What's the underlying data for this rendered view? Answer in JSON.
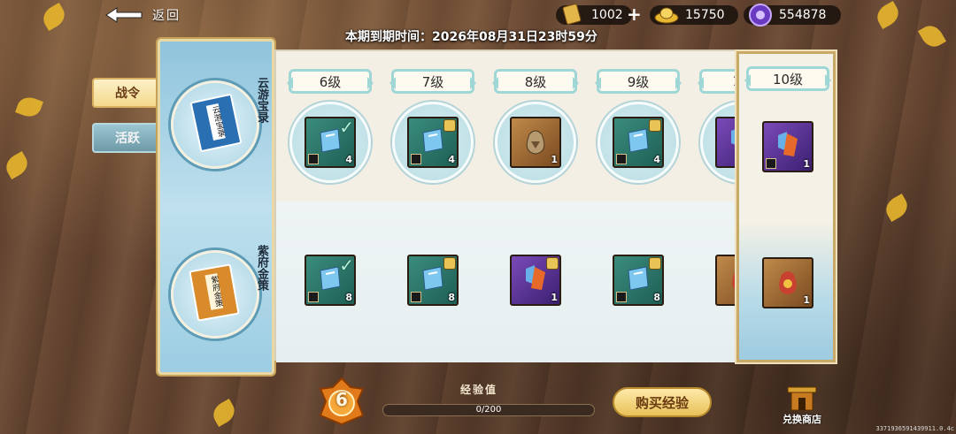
{
  "header": {
    "back_label": "返回",
    "expire_text": "本期到期时间：2026年08月31日23时59分"
  },
  "currencies": [
    {
      "name": "ticket",
      "icon": "ticket-icon",
      "value": "1002",
      "has_add": true
    },
    {
      "name": "gold-ingot",
      "icon": "gold-ingot-icon",
      "value": "15750",
      "has_add": false
    },
    {
      "name": "purple-gem",
      "icon": "purple-gem-icon",
      "value": "554878",
      "has_add": false
    }
  ],
  "side_tabs": [
    {
      "label": "战令",
      "active": true
    },
    {
      "label": "活跃",
      "active": false
    }
  ],
  "tracks": [
    {
      "label": "云游宝录",
      "book_title": "云游宝录",
      "color": "#2b6fb3"
    },
    {
      "label": "紫府金策",
      "book_title": "紫府金策",
      "color": "#d98a2a"
    }
  ],
  "levels": [
    {
      "label": "6级",
      "free": {
        "icon": "jade-shield-icon",
        "type": "green",
        "count": "4",
        "claimed": true,
        "locked": false
      },
      "premium": {
        "icon": "jade-shield-icon",
        "type": "green",
        "count": "8",
        "claimed": true,
        "locked": false
      }
    },
    {
      "label": "7级",
      "free": {
        "icon": "jade-shield-icon",
        "type": "green",
        "count": "4",
        "claimed": false,
        "locked": true
      },
      "premium": {
        "icon": "jade-shield-icon",
        "type": "green",
        "count": "8",
        "claimed": false,
        "locked": true
      }
    },
    {
      "label": "8级",
      "free": {
        "icon": "treasure-bag-icon",
        "type": "bag",
        "count": "1",
        "claimed": false,
        "locked": false
      },
      "premium": {
        "icon": "equipment-set-icon",
        "type": "purple",
        "count": "1",
        "claimed": false,
        "locked": true
      }
    },
    {
      "label": "9级",
      "free": {
        "icon": "jade-shield-icon",
        "type": "green",
        "count": "4",
        "claimed": false,
        "locked": true
      },
      "premium": {
        "icon": "jade-shield-icon",
        "type": "green",
        "count": "8",
        "claimed": false,
        "locked": true
      }
    },
    {
      "label": "10",
      "free": {
        "icon": "equipment-set-icon",
        "type": "purple",
        "count": "",
        "claimed": false,
        "locked": false
      },
      "premium": {
        "icon": "fortune-bag-icon",
        "type": "gold",
        "count": "",
        "claimed": false,
        "locked": false
      }
    }
  ],
  "preview": {
    "label": "10级",
    "free": {
      "icon": "equipment-set-icon",
      "type": "purple",
      "count": "1"
    },
    "premium": {
      "icon": "fortune-bag-icon",
      "type": "gold",
      "count": "1"
    }
  },
  "footer": {
    "current_level": "6",
    "exp_title": "经验值",
    "exp_text": "0/200",
    "exp_progress": 0,
    "buy_label": "购买经验",
    "shop_label": "兑换商店",
    "version": "3371936591439911.0.4c"
  }
}
